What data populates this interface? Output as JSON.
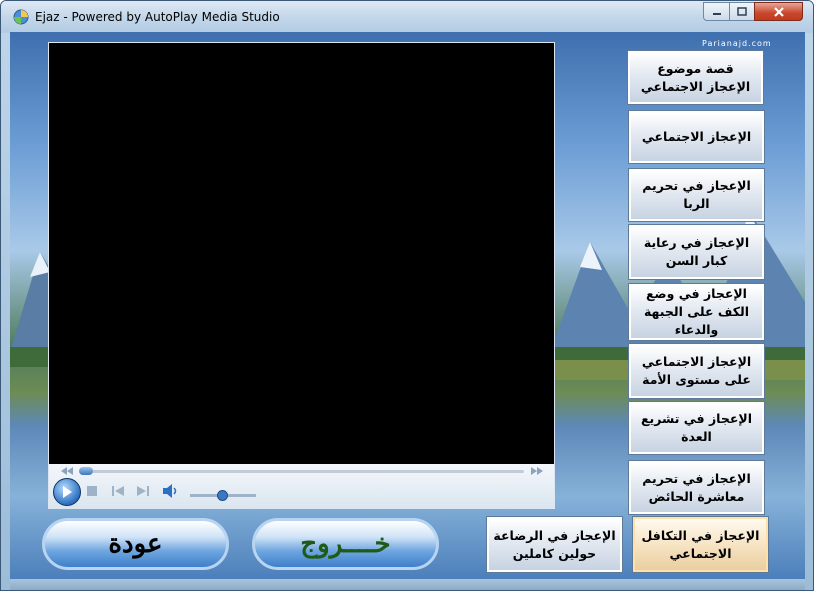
{
  "window": {
    "title": "Ejaz - Powered by AutoPlay Media Studio",
    "controls": {
      "minimize_icon": "minimize-icon",
      "maximize_icon": "maximize-icon",
      "close_icon": "close-icon"
    }
  },
  "watermark": "Parianajd.com",
  "player": {
    "seek_progress": 0.0,
    "volume_level": 0.5,
    "icons": [
      "play-icon",
      "stop-icon",
      "previous-icon",
      "next-icon",
      "volume-icon"
    ]
  },
  "menu": [
    {
      "label": "قصة موضوع الإعجاز الاجتماعي",
      "active": false
    },
    {
      "label": "الإعجاز الاجتماعي",
      "active": false
    },
    {
      "label": "الإعجاز في تحريم الربا",
      "active": false
    },
    {
      "label": "الإعجاز في رعاية كبار السن",
      "active": false
    },
    {
      "label": "الإعجاز في وضع الكف على الجبهة والدعاء",
      "active": false
    },
    {
      "label": "الإعجاز الاجتماعي على مستوى الأمة",
      "active": false
    },
    {
      "label": "الإعجاز في تشريع العدة",
      "active": false
    },
    {
      "label": "الإعجاز في تحريم معاشرة الحائض",
      "active": false
    },
    {
      "label": "الإعجاز في الرضاعة حولين كاملين",
      "active": false
    },
    {
      "label": "الإعجاز في التكافل الاجتماعي",
      "active": true
    }
  ],
  "buttons": {
    "back": "عودة",
    "exit": "خــــروج",
    "back_color": "#000000",
    "exit_color": "#1f5b17"
  }
}
